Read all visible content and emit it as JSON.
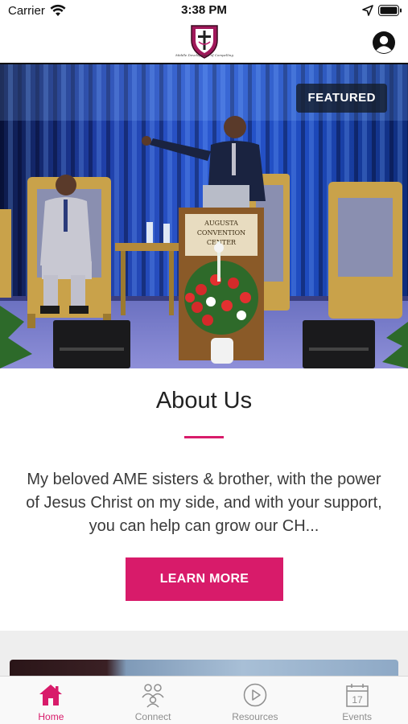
{
  "status_bar": {
    "carrier": "Carrier",
    "time": "3:38 PM",
    "icons": [
      "wifi-icon",
      "location-arrow-icon",
      "battery-icon"
    ]
  },
  "header": {
    "logo_caption": "Middle Development of Compelling",
    "profile_icon": "user-circle-icon"
  },
  "hero": {
    "badge": "FEATURED",
    "podium_sign": [
      "AUGUSTA",
      "CONVENTION",
      "CENTER"
    ]
  },
  "about": {
    "title": "About Us",
    "body": "My beloved AME sisters & brother, with the power of Jesus Christ on my side, and with your support, you can help can grow our CH...",
    "button_label": "LEARN MORE"
  },
  "tabs": [
    {
      "label": "Home",
      "icon": "home-icon",
      "active": true
    },
    {
      "label": "Connect",
      "icon": "people-icon",
      "active": false
    },
    {
      "label": "Resources",
      "icon": "play-circle-icon",
      "active": false
    },
    {
      "label": "Events",
      "icon": "calendar-icon",
      "active": false
    }
  ],
  "calendar_day": "17",
  "colors": {
    "accent": "#d81b6a",
    "tab_inactive": "#8e8e8e",
    "badge_bg": "#141c28"
  }
}
